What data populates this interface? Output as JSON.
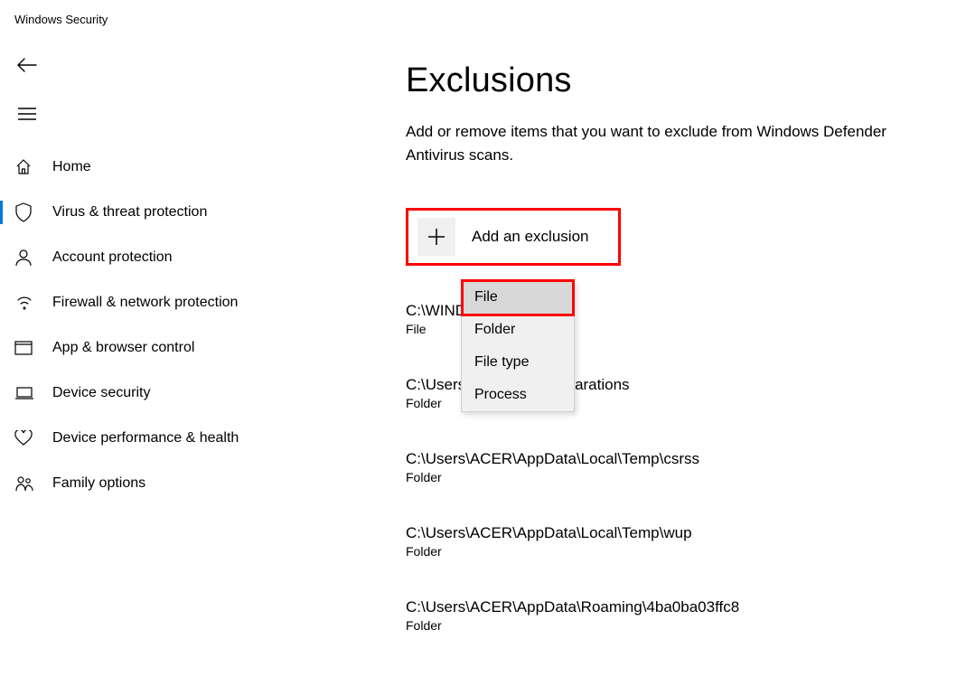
{
  "app_title": "Windows Security",
  "sidebar": {
    "items": [
      {
        "label": "Home",
        "icon": "home"
      },
      {
        "label": "Virus & threat protection",
        "icon": "shield",
        "selected": true
      },
      {
        "label": "Account protection",
        "icon": "person"
      },
      {
        "label": "Firewall & network protection",
        "icon": "signal"
      },
      {
        "label": "App & browser control",
        "icon": "app"
      },
      {
        "label": "Device security",
        "icon": "device"
      },
      {
        "label": "Device performance & health",
        "icon": "heart"
      },
      {
        "label": "Family options",
        "icon": "family"
      }
    ]
  },
  "page": {
    "title": "Exclusions",
    "description": "Add or remove items that you want to exclude from Windows Defender Antivirus scans.",
    "add_button_label": "Add an exclusion"
  },
  "dropdown": {
    "items": [
      {
        "label": "File",
        "highlight": true
      },
      {
        "label": "Folder"
      },
      {
        "label": "File type"
      },
      {
        "label": "Process"
      }
    ]
  },
  "exclusions": [
    {
      "path_visible": "C:\\WIND                             der.exe",
      "type": "File"
    },
    {
      "path_visible": "C:\\Users\\                            Celemony\\Separations",
      "type": "Folder"
    },
    {
      "path_visible": "C:\\Users\\ACER\\AppData\\Local\\Temp\\csrss",
      "type": "Folder"
    },
    {
      "path_visible": "C:\\Users\\ACER\\AppData\\Local\\Temp\\wup",
      "type": "Folder"
    },
    {
      "path_visible": "C:\\Users\\ACER\\AppData\\Roaming\\4ba0ba03ffc8",
      "type": "Folder"
    }
  ]
}
